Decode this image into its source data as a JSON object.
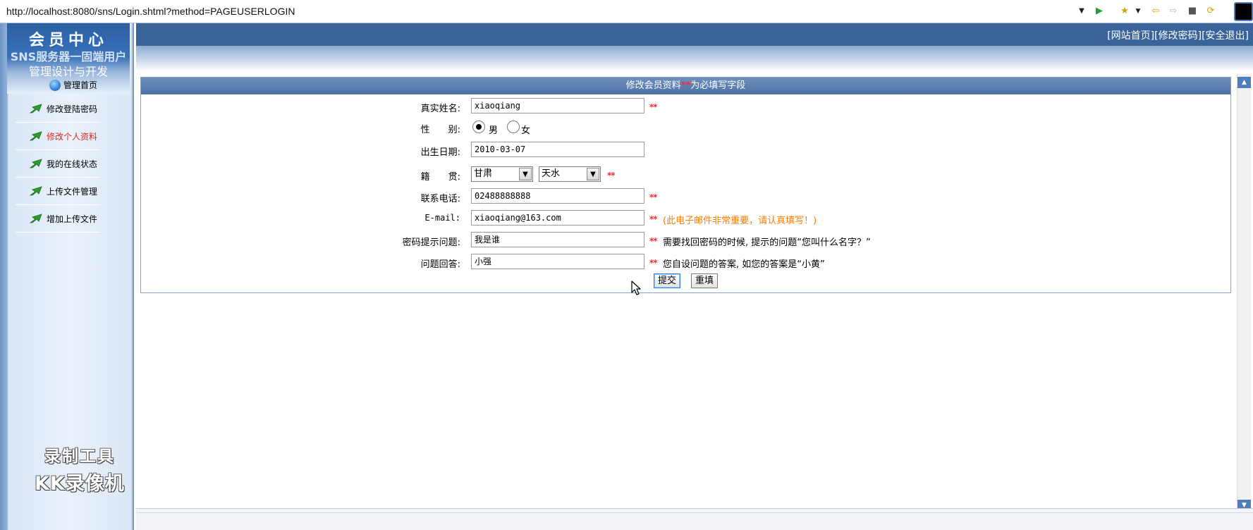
{
  "browser": {
    "url": "http://localhost:8080/sns/Login.shtml?method=PAGEUSERLOGIN",
    "toolbar_icons": [
      "dropdown-icon",
      "go-icon",
      "favorites-icon",
      "back-icon",
      "forward-icon",
      "stop-icon",
      "refresh-icon"
    ]
  },
  "sidebar": {
    "title": "会员中心",
    "subtitle1": "SNS服务器一固端用户",
    "subtitle2": "管理设计与开发",
    "manage_label": "管理首页",
    "items": [
      {
        "label": "修改登陆密码",
        "active": false
      },
      {
        "label": "修改个人资料",
        "active": true
      },
      {
        "label": "我的在线状态",
        "active": false
      },
      {
        "label": "上传文件管理",
        "active": false
      },
      {
        "label": "增加上传文件",
        "active": false
      }
    ],
    "watermark_line1": "录制工具",
    "watermark_line2": "KK录像机"
  },
  "header": {
    "links": [
      "[网站首页]",
      "[修改密码]",
      "[安全退出]"
    ]
  },
  "form": {
    "title": "修改会员资料",
    "required_mark": "**",
    "required_note": "为必填写字段",
    "fields": {
      "realname": {
        "label": "真实姓名:",
        "value": "xiaoqiang"
      },
      "gender": {
        "label": "性　　别:",
        "options": [
          "男",
          "女"
        ],
        "selected": "男"
      },
      "birthday": {
        "label": "出生日期:",
        "value": "2010-03-07"
      },
      "hometown": {
        "label": "籍　　贯:",
        "province": "甘肃",
        "city": "天水"
      },
      "phone": {
        "label": "联系电话:",
        "value": "02488888888"
      },
      "email": {
        "label": "E-mail:",
        "value": "xiaoqiang@163.com",
        "hint": "(此电子邮件非常重要，请认真填写！)"
      },
      "question": {
        "label": "密码提示问题:",
        "value": "我是谁",
        "hint": "需要找回密码的时候, 提示的问题“您叫什么名字？”"
      },
      "answer": {
        "label": "问题回答:",
        "value": "小强",
        "hint": "您自设问题的答案, 如您的答案是“小黄”"
      }
    },
    "submit_label": "提交",
    "reset_label": "重填"
  },
  "colors": {
    "header_blue": "#3a6499",
    "required_red": "#ff2a2a",
    "hint_orange": "#ff7a00",
    "active_menu_red": "#e1261c"
  }
}
